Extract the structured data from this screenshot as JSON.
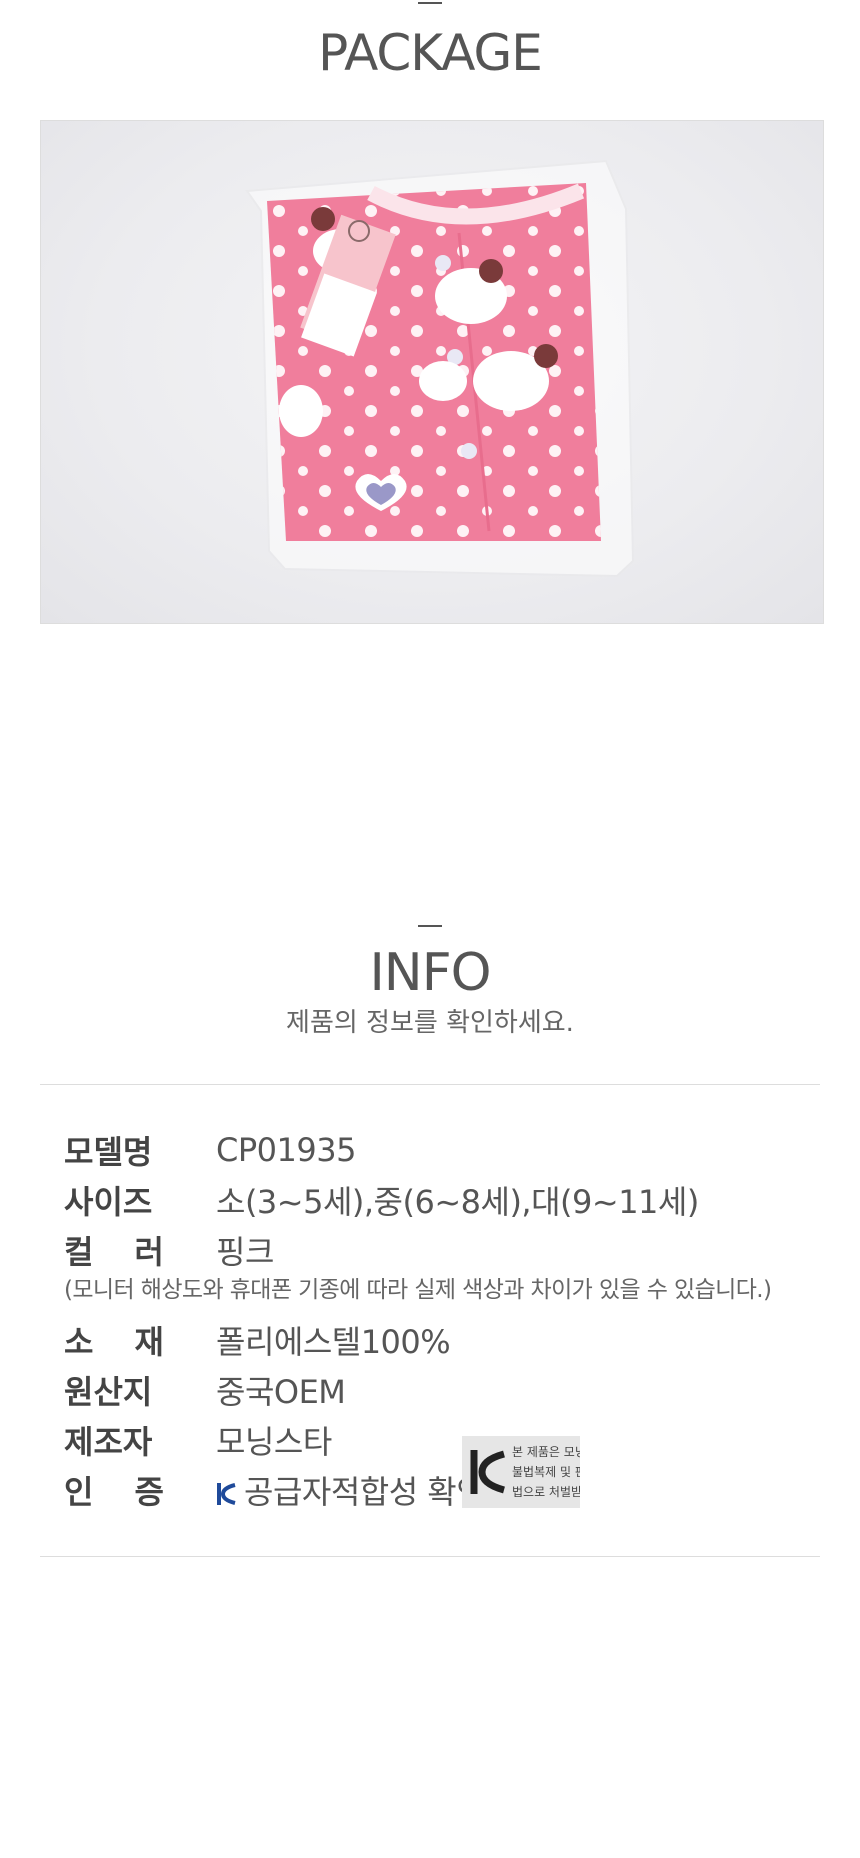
{
  "package": {
    "title": "PACKAGE"
  },
  "info": {
    "title": "INFO",
    "subtitle": "제품의 정보를 확인하세요.",
    "rows": {
      "model": {
        "label": "모델명",
        "value": "CP01935"
      },
      "size": {
        "label": "사이즈",
        "value": "소(3~5세),중(6~8세),대(9~11세)"
      },
      "color": {
        "label_chars": [
          "컬",
          "러"
        ],
        "value": "핑크"
      },
      "color_note": "(모니터 해상도와 휴대폰 기종에 따라 실제 색상과 차이가 있을 수 있습니다.)",
      "material": {
        "label_chars": [
          "소",
          "재"
        ],
        "value": "폴리에스텔100%"
      },
      "origin": {
        "label": "원산지",
        "value": "중국OEM"
      },
      "maker": {
        "label": "제조자",
        "value": "모닝스타"
      },
      "cert": {
        "label_chars": [
          "인",
          "증"
        ],
        "value": "공급자적합성 확인"
      }
    },
    "kc_mark_text": [
      "본 제품은 모닝",
      "불법복제 및 판",
      "법으로 처벌받"
    ]
  },
  "colors": {
    "accent_pink": "#f27c9a",
    "text": "#555555",
    "rule": "#dddddd",
    "kc_blue": "#1f4a9a"
  }
}
